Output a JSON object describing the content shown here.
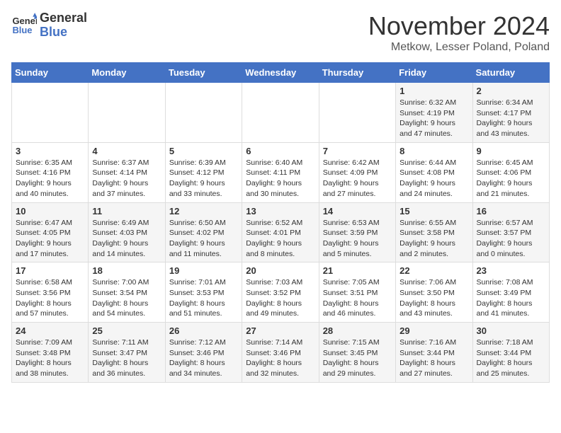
{
  "header": {
    "logo_line1": "General",
    "logo_line2": "Blue",
    "month": "November 2024",
    "location": "Metkow, Lesser Poland, Poland"
  },
  "days_of_week": [
    "Sunday",
    "Monday",
    "Tuesday",
    "Wednesday",
    "Thursday",
    "Friday",
    "Saturday"
  ],
  "weeks": [
    [
      {
        "day": "",
        "info": ""
      },
      {
        "day": "",
        "info": ""
      },
      {
        "day": "",
        "info": ""
      },
      {
        "day": "",
        "info": ""
      },
      {
        "day": "",
        "info": ""
      },
      {
        "day": "1",
        "info": "Sunrise: 6:32 AM\nSunset: 4:19 PM\nDaylight: 9 hours and 47 minutes."
      },
      {
        "day": "2",
        "info": "Sunrise: 6:34 AM\nSunset: 4:17 PM\nDaylight: 9 hours and 43 minutes."
      }
    ],
    [
      {
        "day": "3",
        "info": "Sunrise: 6:35 AM\nSunset: 4:16 PM\nDaylight: 9 hours and 40 minutes."
      },
      {
        "day": "4",
        "info": "Sunrise: 6:37 AM\nSunset: 4:14 PM\nDaylight: 9 hours and 37 minutes."
      },
      {
        "day": "5",
        "info": "Sunrise: 6:39 AM\nSunset: 4:12 PM\nDaylight: 9 hours and 33 minutes."
      },
      {
        "day": "6",
        "info": "Sunrise: 6:40 AM\nSunset: 4:11 PM\nDaylight: 9 hours and 30 minutes."
      },
      {
        "day": "7",
        "info": "Sunrise: 6:42 AM\nSunset: 4:09 PM\nDaylight: 9 hours and 27 minutes."
      },
      {
        "day": "8",
        "info": "Sunrise: 6:44 AM\nSunset: 4:08 PM\nDaylight: 9 hours and 24 minutes."
      },
      {
        "day": "9",
        "info": "Sunrise: 6:45 AM\nSunset: 4:06 PM\nDaylight: 9 hours and 21 minutes."
      }
    ],
    [
      {
        "day": "10",
        "info": "Sunrise: 6:47 AM\nSunset: 4:05 PM\nDaylight: 9 hours and 17 minutes."
      },
      {
        "day": "11",
        "info": "Sunrise: 6:49 AM\nSunset: 4:03 PM\nDaylight: 9 hours and 14 minutes."
      },
      {
        "day": "12",
        "info": "Sunrise: 6:50 AM\nSunset: 4:02 PM\nDaylight: 9 hours and 11 minutes."
      },
      {
        "day": "13",
        "info": "Sunrise: 6:52 AM\nSunset: 4:01 PM\nDaylight: 9 hours and 8 minutes."
      },
      {
        "day": "14",
        "info": "Sunrise: 6:53 AM\nSunset: 3:59 PM\nDaylight: 9 hours and 5 minutes."
      },
      {
        "day": "15",
        "info": "Sunrise: 6:55 AM\nSunset: 3:58 PM\nDaylight: 9 hours and 2 minutes."
      },
      {
        "day": "16",
        "info": "Sunrise: 6:57 AM\nSunset: 3:57 PM\nDaylight: 9 hours and 0 minutes."
      }
    ],
    [
      {
        "day": "17",
        "info": "Sunrise: 6:58 AM\nSunset: 3:56 PM\nDaylight: 8 hours and 57 minutes."
      },
      {
        "day": "18",
        "info": "Sunrise: 7:00 AM\nSunset: 3:54 PM\nDaylight: 8 hours and 54 minutes."
      },
      {
        "day": "19",
        "info": "Sunrise: 7:01 AM\nSunset: 3:53 PM\nDaylight: 8 hours and 51 minutes."
      },
      {
        "day": "20",
        "info": "Sunrise: 7:03 AM\nSunset: 3:52 PM\nDaylight: 8 hours and 49 minutes."
      },
      {
        "day": "21",
        "info": "Sunrise: 7:05 AM\nSunset: 3:51 PM\nDaylight: 8 hours and 46 minutes."
      },
      {
        "day": "22",
        "info": "Sunrise: 7:06 AM\nSunset: 3:50 PM\nDaylight: 8 hours and 43 minutes."
      },
      {
        "day": "23",
        "info": "Sunrise: 7:08 AM\nSunset: 3:49 PM\nDaylight: 8 hours and 41 minutes."
      }
    ],
    [
      {
        "day": "24",
        "info": "Sunrise: 7:09 AM\nSunset: 3:48 PM\nDaylight: 8 hours and 38 minutes."
      },
      {
        "day": "25",
        "info": "Sunrise: 7:11 AM\nSunset: 3:47 PM\nDaylight: 8 hours and 36 minutes."
      },
      {
        "day": "26",
        "info": "Sunrise: 7:12 AM\nSunset: 3:46 PM\nDaylight: 8 hours and 34 minutes."
      },
      {
        "day": "27",
        "info": "Sunrise: 7:14 AM\nSunset: 3:46 PM\nDaylight: 8 hours and 32 minutes."
      },
      {
        "day": "28",
        "info": "Sunrise: 7:15 AM\nSunset: 3:45 PM\nDaylight: 8 hours and 29 minutes."
      },
      {
        "day": "29",
        "info": "Sunrise: 7:16 AM\nSunset: 3:44 PM\nDaylight: 8 hours and 27 minutes."
      },
      {
        "day": "30",
        "info": "Sunrise: 7:18 AM\nSunset: 3:44 PM\nDaylight: 8 hours and 25 minutes."
      }
    ]
  ]
}
